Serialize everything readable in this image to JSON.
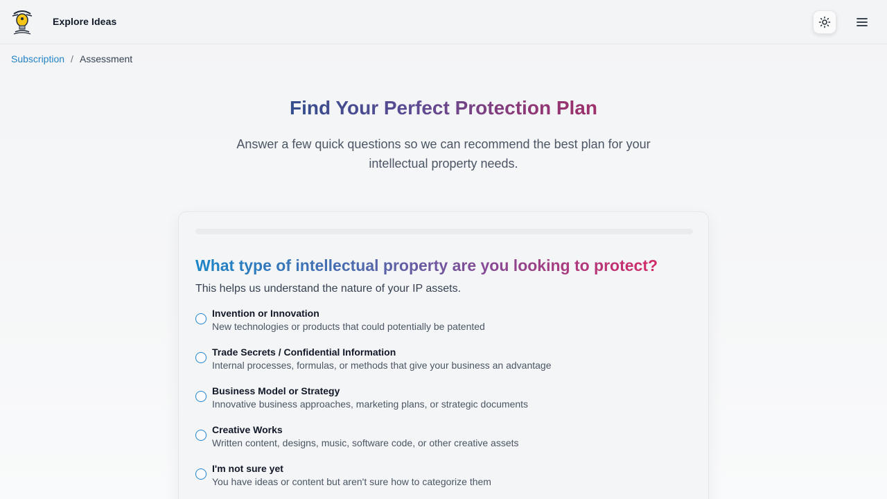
{
  "header": {
    "brand": "Explore Ideas",
    "logo_icon": "lightbulb-person-icon",
    "theme_icon": "sun-icon",
    "menu_icon": "hamburger-menu-icon"
  },
  "breadcrumb": {
    "items": [
      {
        "label": "Subscription",
        "link": true
      },
      {
        "label": "Assessment",
        "link": false
      }
    ],
    "separator": "/"
  },
  "hero": {
    "title": "Find Your Perfect Protection Plan",
    "subtitle": "Answer a few quick questions so we can recommend the best plan for your intellectual property needs."
  },
  "question": {
    "progress_fraction": 0,
    "title": "What type of intellectual property are you looking to protect?",
    "help": "This helps us understand the nature of your IP assets.",
    "options": [
      {
        "label": "Invention or Innovation",
        "description": "New technologies or products that could potentially be patented"
      },
      {
        "label": "Trade Secrets / Confidential Information",
        "description": "Internal processes, formulas, or methods that give your business an advantage"
      },
      {
        "label": "Business Model or Strategy",
        "description": "Innovative business approaches, marketing plans, or strategic documents"
      },
      {
        "label": "Creative Works",
        "description": "Written content, designs, music, software code, or other creative assets"
      },
      {
        "label": "I'm not sure yet",
        "description": "You have ideas or content but aren't sure how to categorize them"
      }
    ]
  },
  "colors": {
    "accent": "#2383c6",
    "title_gradient": [
      "#334d8c",
      "#9d2f6a"
    ],
    "question_gradient": [
      "#1b86c8",
      "#d22a67"
    ]
  }
}
